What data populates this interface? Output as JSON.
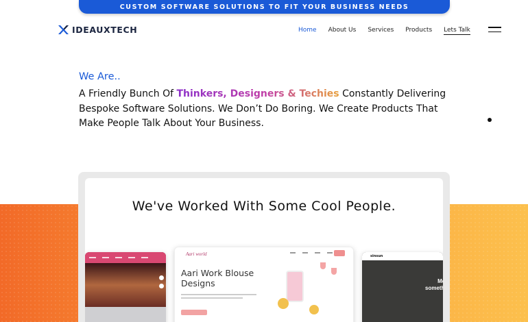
{
  "banner": {
    "text": "CUSTOM SOFTWARE SOLUTIONS TO FIT YOUR BUSINESS NEEDS"
  },
  "header": {
    "logo_text": "IDEAUXTECH",
    "nav": [
      "Home",
      "About Us",
      "Services",
      "Products",
      "Lets Talk"
    ],
    "active_nav": "Home"
  },
  "intro": {
    "heading": "We Are..",
    "text_before": "A Friendly Bunch Of ",
    "highlight": "Thinkers, Designers & Techies",
    "text_after": " Constantly Delivering Bespoke Software Solutions. We Don’t Do Boring. We Create Products That Make People Talk About Your Business."
  },
  "clients": {
    "title": "We've Worked With Some Cool People.",
    "thumb2": {
      "brand": "Aari world",
      "headline_line1": "Aari Work Blouse",
      "headline_line2": "Designs"
    },
    "thumb3": {
      "brand": "sinsun",
      "line1": "Men's",
      "line2": "something"
    }
  },
  "colors": {
    "accent": "#1a5ad7",
    "banner": "#1a5ad7",
    "band_start": "#f26a28",
    "band_end": "#fcc04d"
  }
}
